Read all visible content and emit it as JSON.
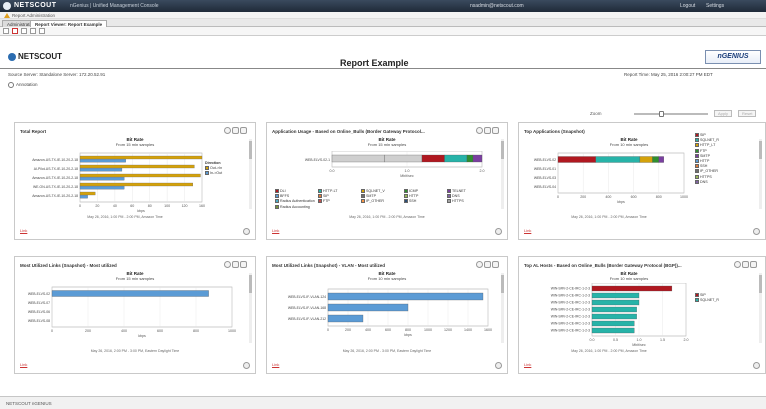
{
  "topbar": {
    "brand": "NETSCOUT",
    "subtitle": "nGenius | Unified Management Console",
    "user": "nsadmin@netscout.com",
    "links": [
      "Logout",
      "Settings"
    ]
  },
  "warning": {
    "text": "Report Administration"
  },
  "tabs": [
    {
      "label": "Administration"
    },
    {
      "label": "Report Viewer: Report Example"
    }
  ],
  "header": {
    "logo_text": "NETSCOUT",
    "title": "Report Example",
    "partner_logo": "nGENIUS",
    "source_line": "Source Server: Standalone Server: 172.20.52.91",
    "report_time": "Report Time: May 25, 2016 2:00:27 PM EDT",
    "annotation_label": "Annotation"
  },
  "zoom": {
    "label": "Zoom",
    "level": 0.35,
    "buttons": [
      "Apply",
      "Reset"
    ]
  },
  "colors": {
    "gold": "#d4a20a",
    "blue": "#5b9bd5",
    "crimson": "#b01820",
    "teal": "#27b3a8",
    "green": "#2f8f2f",
    "purple": "#7a3fa0",
    "lightgray": "#cfcfcf"
  },
  "panels": [
    {
      "title": "Total Report",
      "chart_title": "Bit Rate",
      "chart_subtitle": "From 15 min samples",
      "footnote": "May 26, 2016, 1:00 PM - 2:00 PM, Amazon Time",
      "link": "Link"
    },
    {
      "title": "Application Usage - Based on Online_Bulls (Border Gateway Protocol...",
      "chart_title": "Bit Rate",
      "chart_subtitle": "From 15 min samples",
      "footnote": "May 26, 2016, 1:00 PM - 2:00 PM, Amazon Time",
      "link": "Link"
    },
    {
      "title": "Top Applications (Snapshot)",
      "chart_title": "Bit Rate",
      "chart_subtitle": "From 10 min samples",
      "footnote": "May 26, 2016, 1:00 PM - 2:00 PM, Amazon Time",
      "link": "Link"
    },
    {
      "title": "Most Utilized Links (Snapshot) - Most utilized",
      "chart_title": "Bit Rate",
      "chart_subtitle": "From 15 min samples",
      "footnote": "May 26, 2016, 2:00 PM - 3:00 PM, Eastern Daylight Time",
      "link": "Link"
    },
    {
      "title": "Most Utilized Links (Snapshot) - VLAN - Most utilized",
      "chart_title": "Bit Rate",
      "chart_subtitle": "From 10 min samples",
      "footnote": "May 26, 2016, 2:00 PM - 3:00 PM, Eastern Daylight Time",
      "link": "Link"
    },
    {
      "title": "Top AL Hosts - Based on Online_Bulls (Border Gateway Protocol (BGP))...",
      "chart_title": "Bit Rate",
      "chart_subtitle": "From 10 min samples",
      "footnote": "May 26, 2016, 1:00 PM - 2:00 PM, Amazon Time",
      "link": "Link"
    }
  ],
  "chart_data": [
    {
      "type": "bar",
      "orientation": "horizontal",
      "categories": [
        "Amazon-US-TX-IE-10-20-2-18",
        "AI-Pilot-US-TX-IE-10-20-2-18",
        "Amazon-US-TX-IE-10-20-2-18",
        "WE-ON-US-TX-IE-10-20-2-18",
        "Amazon-US-TX-IE-10-20-2-18"
      ],
      "series": [
        {
          "name": "Out->In",
          "values": [
            160,
            150,
            158,
            148,
            20
          ]
        },
        {
          "name": "In->Out",
          "values": [
            60,
            55,
            58,
            58,
            10
          ]
        }
      ],
      "legend_title": "Direction",
      "xlim": [
        0,
        160
      ],
      "xticks": [
        "0",
        "20",
        "40",
        "60",
        "80",
        "100",
        "120",
        "160"
      ],
      "xlabel": "kbps"
    },
    {
      "type": "bar",
      "stacked": true,
      "orientation": "horizontal",
      "categories": [
        "WEB-ELVS-02-1"
      ],
      "segments": [
        0.35,
        0.25,
        0.15,
        0.15,
        0.04,
        0.06
      ],
      "xlim": [
        0,
        2.0
      ],
      "xticks": [
        "0.0",
        "1.0",
        "2.0"
      ],
      "xlabel": "Mbit/sec",
      "legend": [
        "DLI",
        "HTTP-LT",
        "SQLNET_V",
        "ICMP",
        "TELNET",
        "BFFS",
        "SIP",
        "SMTP",
        "HTTP",
        "DNS",
        "Radius Authentication",
        "FTP",
        "IP_OTHER",
        "SSH",
        "HTTPS",
        "Radius Accounting"
      ]
    },
    {
      "type": "bar",
      "stacked": true,
      "orientation": "horizontal",
      "categories": [
        "WEB-ELVS-02",
        "WEB-ELVS-01",
        "WEB-ELVS-03",
        "WEB-ELVS-04"
      ],
      "segments": [
        0.3,
        0.35,
        0.1,
        0.05,
        0.04
      ],
      "xlim": [
        0,
        1000
      ],
      "xticks": [
        "0",
        "200",
        "400",
        "600",
        "800",
        "1000"
      ],
      "xlabel": "kbps",
      "legend": [
        "SIP",
        "SQLNET_R",
        "HTTP_LT",
        "FTP",
        "SMTP",
        "HTTP",
        "SSH",
        "IP_OTHER",
        "HTTPS",
        "DNS"
      ]
    },
    {
      "type": "bar",
      "orientation": "horizontal",
      "categories": [
        "WEB-ELVS-02",
        "WEB-ELVS-07",
        "WEB-ELVS-06",
        "WEB-ELVS-08"
      ],
      "values": [
        870,
        0,
        0,
        0
      ],
      "xlim": [
        0,
        1000
      ],
      "xticks": [
        "0",
        "200",
        "400",
        "600",
        "800",
        "1000"
      ],
      "xlabel": "kbps"
    },
    {
      "type": "bar",
      "orientation": "horizontal",
      "categories": [
        "WEB-ELVS-IF-VLAN-124",
        "WEB-ELVS-IF-VLAN-168",
        "WEB-ELVS-IF-VLAN-212"
      ],
      "values": [
        1550,
        800,
        350
      ],
      "xlim": [
        0,
        1600
      ],
      "xticks": [
        "0",
        "200",
        "400",
        "600",
        "800",
        "1000",
        "1200",
        "1400",
        "1600"
      ],
      "xlabel": "kbps"
    },
    {
      "type": "bar",
      "stacked": true,
      "orientation": "horizontal",
      "categories": [
        "WIN-SRV-2-CE-IRC-1-2-3",
        "WIN-SRV-2-CE-IRC-1-2-3",
        "WIN-SRV-2-CE-IRC-1-2-3",
        "WIN-SRV-2-CE-IRC-1-2-3",
        "WIN-SRV-2-CE-IRC-1-2-3",
        "WIN-SRV-2-CE-IRC-1-2-3",
        "WIN-SRV-2-CE-IRC-1-2-3"
      ],
      "series": [
        {
          "name": "SIP",
          "values": [
            1.7,
            0,
            0,
            0,
            0,
            0,
            0
          ]
        },
        {
          "name": "SQLNET_R",
          "values": [
            0,
            1.0,
            1.0,
            0.95,
            0.95,
            0.9,
            0.9
          ]
        }
      ],
      "xlim": [
        0,
        2
      ],
      "xticks": [
        "0.0",
        "0.5",
        "1.0",
        "1.5",
        "2.0"
      ],
      "xlabel": "Mbit/sec"
    }
  ],
  "footer": {
    "text": "NETSCOUT nGENIUS"
  }
}
